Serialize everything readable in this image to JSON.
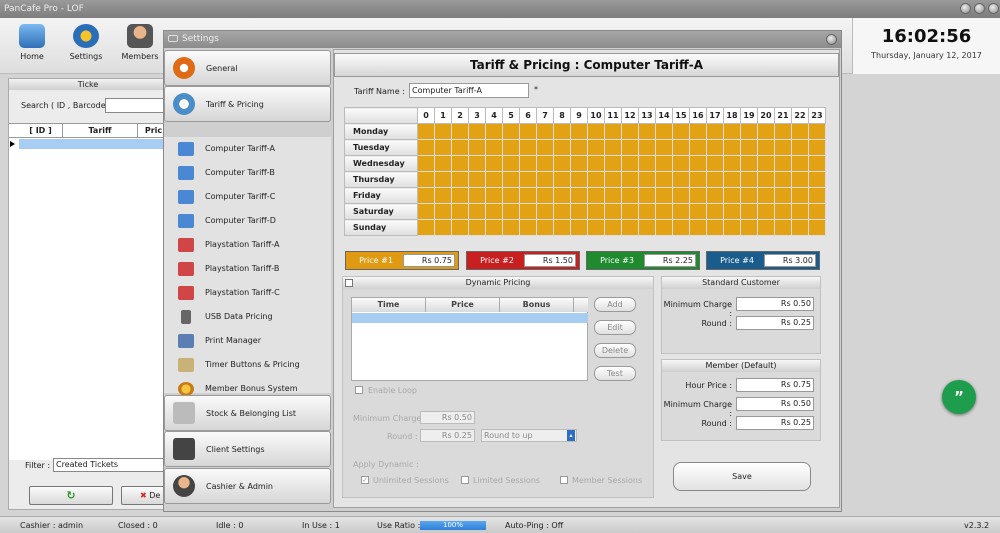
{
  "window": {
    "title": "PanCafe Pro - LOF"
  },
  "toolbar": {
    "items": [
      {
        "label": "Home",
        "icon": "home-icon"
      },
      {
        "label": "Settings",
        "icon": "gear-icon"
      },
      {
        "label": "Members",
        "icon": "members-icon"
      }
    ]
  },
  "clock": {
    "time": "16:02:56",
    "date": "Thursday, January 12, 2017"
  },
  "tickets": {
    "title": "Ticke",
    "search_label": "Search ( ID , Barcode )",
    "columns": [
      "[ ID ]",
      "Tariff",
      "Pric"
    ],
    "filter_label": "Filter :",
    "filter_value": "Created Tickets",
    "delete_label": "De"
  },
  "settings": {
    "title": "Settings",
    "sections": {
      "general": "General",
      "tariff": "Tariff & Pricing",
      "stock": "Stock & Belonging List",
      "client": "Client Settings",
      "cashier": "Cashier & Admin"
    },
    "subitems": [
      "Computer Tariff-A",
      "Computer Tariff-B",
      "Computer Tariff-C",
      "Computer Tariff-D",
      "Playstation Tariff-A",
      "Playstation Tariff-B",
      "Playstation Tariff-C",
      "USB Data Pricing",
      "Print Manager",
      "Timer Buttons & Pricing",
      "Member Bonus System"
    ]
  },
  "tariff": {
    "header": "Tariff & Pricing : Computer Tariff-A",
    "name_label": "Tariff Name :",
    "name_value": "Computer Tariff-A",
    "required_mark": "*",
    "hours": [
      "0",
      "1",
      "2",
      "3",
      "4",
      "5",
      "6",
      "7",
      "8",
      "9",
      "10",
      "11",
      "12",
      "13",
      "14",
      "15",
      "16",
      "17",
      "18",
      "19",
      "20",
      "21",
      "22",
      "23"
    ],
    "days": [
      "Monday",
      "Tuesday",
      "Wednesday",
      "Thursday",
      "Friday",
      "Saturday",
      "Sunday"
    ],
    "prices": [
      {
        "label": "Price #1",
        "value": "Rs 0.75",
        "color": "#e09a12"
      },
      {
        "label": "Price #2",
        "value": "Rs 1.50",
        "color": "#c82020"
      },
      {
        "label": "Price #3",
        "value": "Rs 2.25",
        "color": "#1f8a2e"
      },
      {
        "label": "Price #4",
        "value": "Rs 3.00",
        "color": "#1a5d8c"
      }
    ]
  },
  "dynamic": {
    "title": "Dynamic Pricing",
    "columns": [
      "Time",
      "Price",
      "Bonus"
    ],
    "buttons": {
      "add": "Add",
      "edit": "Edit",
      "delete": "Delete",
      "test": "Test"
    },
    "enable_loop": "Enable Loop",
    "min_charge_label": "Minimum Charge :",
    "min_charge_value": "Rs 0.50",
    "round_label": "Round :",
    "round_value": "Rs 0.25",
    "round_mode": "Round to up",
    "apply_label": "Apply Dynamic :",
    "apply_options": [
      "Unlimited Sessions",
      "Limited Sessions",
      "Member Sessions"
    ]
  },
  "standard": {
    "title": "Standard Customer",
    "min_label": "Minimum Charge :",
    "min_value": "Rs 0.50",
    "round_label": "Round :",
    "round_value": "Rs 0.25"
  },
  "member": {
    "title": "Member (Default)",
    "hour_label": "Hour Price :",
    "hour_value": "Rs 0.75",
    "min_label": "Minimum Charge :",
    "min_value": "Rs 0.50",
    "round_label": "Round :",
    "round_value": "Rs 0.25"
  },
  "save_label": "Save",
  "status": {
    "cashier": "Cashier : admin",
    "closed": "Closed : 0",
    "idle": "Idle : 0",
    "inuse": "In Use : 1",
    "ratio_label": "Use Ratio :",
    "ratio": "100%",
    "autoping": "Auto-Ping : Off",
    "version": "v2.3.2"
  },
  "fab": {
    "label": "”"
  }
}
